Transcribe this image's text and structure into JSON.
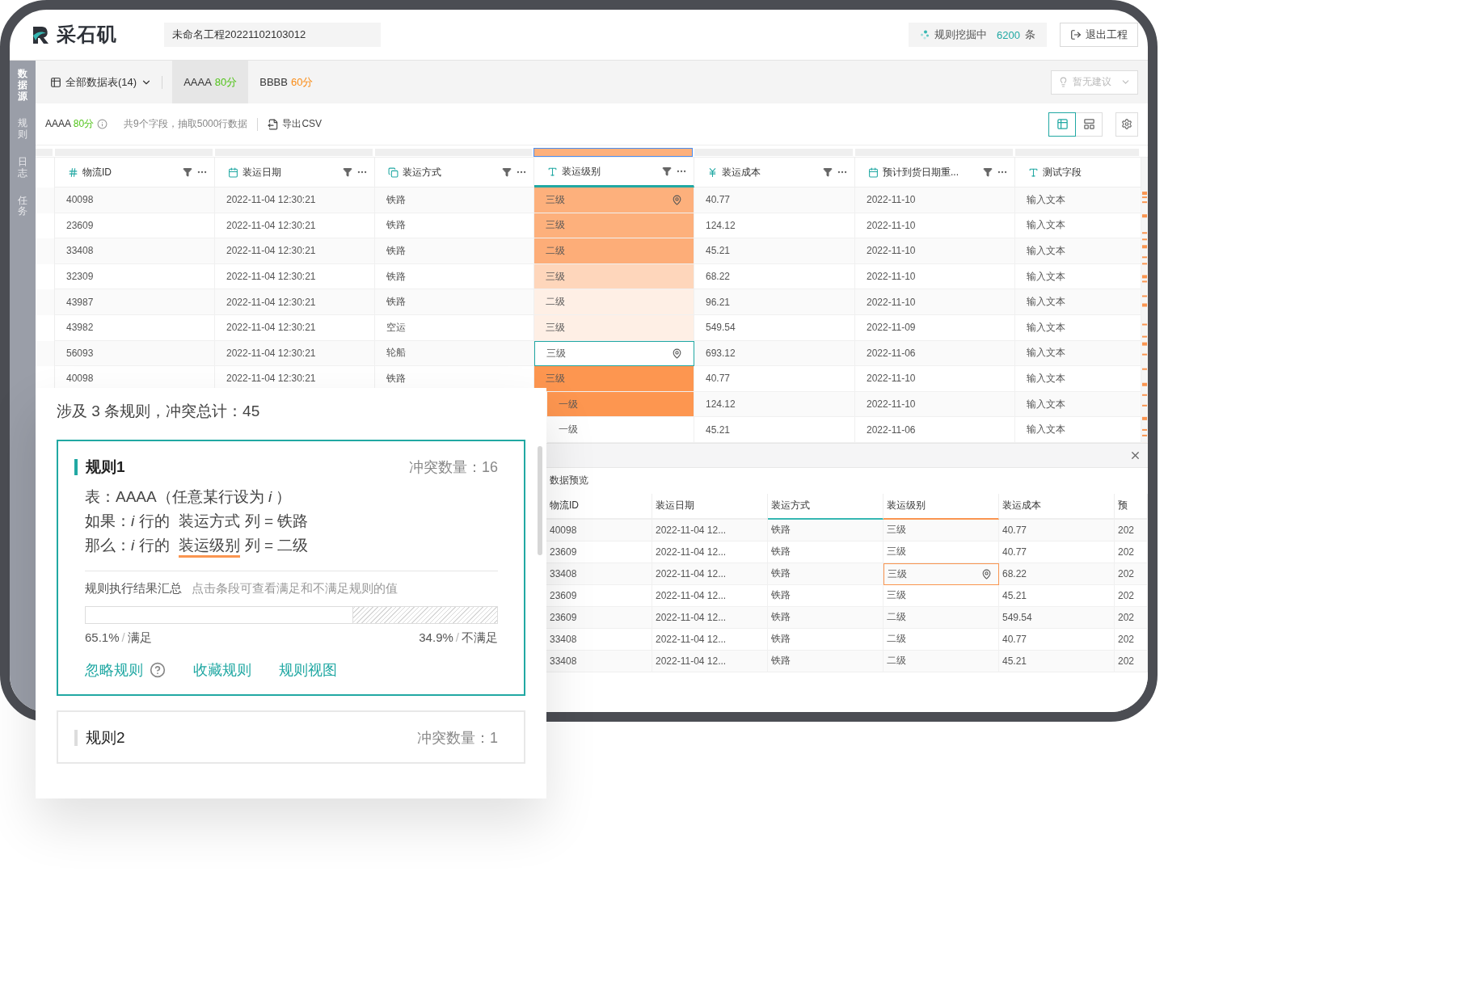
{
  "header": {
    "brand": "采石矶",
    "project_name": "未命名工程20221102103012",
    "mining_status": {
      "label": "规则挖掘中",
      "count": "6200",
      "unit": "条"
    },
    "exit_button": "退出工程"
  },
  "rail": {
    "items": [
      {
        "label": "数据源",
        "selected": true
      },
      {
        "label": "规则",
        "selected": false
      },
      {
        "label": "日志",
        "selected": false
      },
      {
        "label": "任务",
        "selected": false
      }
    ]
  },
  "tabbar": {
    "all_tables": "全部数据表(14)",
    "tabs": [
      {
        "name": "AAAA",
        "score": "80分",
        "color": "#52c41a",
        "selected": true
      },
      {
        "name": "BBBB",
        "score": "60分",
        "color": "#fa8c16",
        "selected": false
      }
    ],
    "suggestion": {
      "label": "暂无建议",
      "disabled": true
    }
  },
  "toolbar": {
    "table_name": "AAAA",
    "score": "80分",
    "color": "#52c41a",
    "summary": "共9个字段，抽取5000行数据",
    "export": "导出CSV",
    "views": [
      {
        "kind": "grid",
        "selected": true
      },
      {
        "kind": "cards",
        "selected": false
      }
    ]
  },
  "table": {
    "columns": [
      {
        "label": "物流ID",
        "kind": "id",
        "selected": false
      },
      {
        "label": "装运日期",
        "kind": "date",
        "selected": false
      },
      {
        "label": "装运方式",
        "kind": "category",
        "selected": false
      },
      {
        "label": "装运级别",
        "kind": "text",
        "selected": true
      },
      {
        "label": "装运成本",
        "kind": "money",
        "selected": false
      },
      {
        "label": "预计到货日期重...",
        "kind": "date",
        "selected": false
      },
      {
        "label": "测试字段",
        "kind": "text",
        "selected": false
      }
    ],
    "rows": [
      {
        "id": "40098",
        "date": "2022-11-04 12:30:21",
        "method": "铁路",
        "grade": "三级",
        "cost": "40.77",
        "eta": "2022-11-10",
        "test": "输入文本",
        "color": "#fdb07c",
        "pinned": true,
        "selected": false
      },
      {
        "id": "23609",
        "date": "2022-11-04 12:30:21",
        "method": "铁路",
        "grade": "三级",
        "cost": "124.12",
        "eta": "2022-11-10",
        "test": "输入文本",
        "color": "#fdb07c",
        "pinned": false,
        "selected": false
      },
      {
        "id": "33408",
        "date": "2022-11-04 12:30:21",
        "method": "铁路",
        "grade": "二级",
        "cost": "45.21",
        "eta": "2022-11-10",
        "test": "输入文本",
        "color": "#fdad78",
        "pinned": false,
        "selected": false
      },
      {
        "id": "32309",
        "date": "2022-11-04 12:30:21",
        "method": "铁路",
        "grade": "三级",
        "cost": "68.22",
        "eta": "2022-11-10",
        "test": "输入文本",
        "color": "#fed6bb",
        "pinned": false,
        "selected": false
      },
      {
        "id": "43987",
        "date": "2022-11-04 12:30:21",
        "method": "铁路",
        "grade": "二级",
        "cost": "96.21",
        "eta": "2022-11-10",
        "test": "输入文本",
        "color": "#feefe5",
        "pinned": false,
        "selected": false
      },
      {
        "id": "43982",
        "date": "2022-11-04 12:30:21",
        "method": "空运",
        "grade": "三级",
        "cost": "549.54",
        "eta": "2022-11-09",
        "test": "输入文本",
        "color": "#feefe5",
        "pinned": false,
        "selected": false
      },
      {
        "id": "56093",
        "date": "2022-11-04 12:30:21",
        "method": "轮船",
        "grade": "三级",
        "cost": "693.12",
        "eta": "2022-11-06",
        "test": "输入文本",
        "color": "#ffffff",
        "pinned": true,
        "selected": true
      },
      {
        "id": "40098",
        "date": "2022-11-04 12:30:21",
        "method": "铁路",
        "grade": "三级",
        "cost": "40.77",
        "eta": "2022-11-10",
        "test": "输入文本",
        "color": "#fd9650",
        "pinned": false,
        "selected": false
      },
      {
        "grade": "一级",
        "cost": "124.12",
        "eta": "2022-11-10",
        "test": "输入文本",
        "color": "#fd9650",
        "pinned": false,
        "selected": false
      },
      {
        "grade": "一级",
        "cost": "45.21",
        "eta": "2022-11-06",
        "test": "输入文本",
        "color": "#ffffff",
        "pinned": false,
        "selected": false
      }
    ]
  },
  "preview": {
    "title": "数据预览",
    "columns": [
      {
        "label": "物流ID"
      },
      {
        "label": "装运日期"
      },
      {
        "label": "装运方式",
        "color": "#36b7b2"
      },
      {
        "label": "装运级别",
        "color": "#fa9550"
      },
      {
        "label": "装运成本"
      },
      {
        "label": "预"
      }
    ],
    "rows": [
      {
        "cells": [
          "40098",
          "2022-11-04 12...",
          "铁路",
          "三级",
          "40.77",
          "202"
        ],
        "flagged": false
      },
      {
        "cells": [
          "23609",
          "2022-11-04 12...",
          "铁路",
          "三级",
          "40.77",
          "202"
        ],
        "flagged": false
      },
      {
        "cells": [
          "33408",
          "2022-11-04 12...",
          "铁路",
          "三级",
          "68.22",
          "202"
        ],
        "flagged": true
      },
      {
        "cells": [
          "23609",
          "2022-11-04 12...",
          "铁路",
          "三级",
          "45.21",
          "202"
        ],
        "flagged": false
      },
      {
        "cells": [
          "23609",
          "2022-11-04 12...",
          "铁路",
          "二级",
          "549.54",
          "202"
        ],
        "flagged": false
      },
      {
        "cells": [
          "33408",
          "2022-11-04 12...",
          "铁路",
          "二级",
          "40.77",
          "202"
        ],
        "flagged": false
      },
      {
        "cells": [
          "33408",
          "2022-11-04 12...",
          "铁路",
          "二级",
          "45.21",
          "202"
        ],
        "flagged": false
      }
    ]
  },
  "conflicts": {
    "summary": "涉及 3 条规则，冲突总计：45",
    "rules": [
      {
        "title": "规则1",
        "count_label": "冲突数量：",
        "count": "16",
        "selected": true,
        "lines": [
          {
            "text": "表：AAAA（任意某行设为 *i* ）"
          },
          {
            "text": "如果：*i* 行的",
            "field": "装运方式",
            "rest": "列 = 铁路",
            "underlined": false
          },
          {
            "text": "那么：*i* 行的",
            "field": "装运级别",
            "rest": "列 = 二级",
            "underlined": true
          }
        ],
        "result": {
          "title": "规则执行结果汇总",
          "hint": "点击条段可查看满足和不满足规则的值",
          "level": 0.651,
          "pass_value": "65.1%",
          "pass_label": "满足",
          "fail_value": "34.9%",
          "fail_label": "不满足",
          "separator": "/"
        },
        "actions": [
          "忽略规则",
          "收藏规则",
          "规则视图"
        ]
      },
      {
        "title": "规则2",
        "count_label": "冲突数量：",
        "count": "1",
        "selected": false
      }
    ]
  }
}
